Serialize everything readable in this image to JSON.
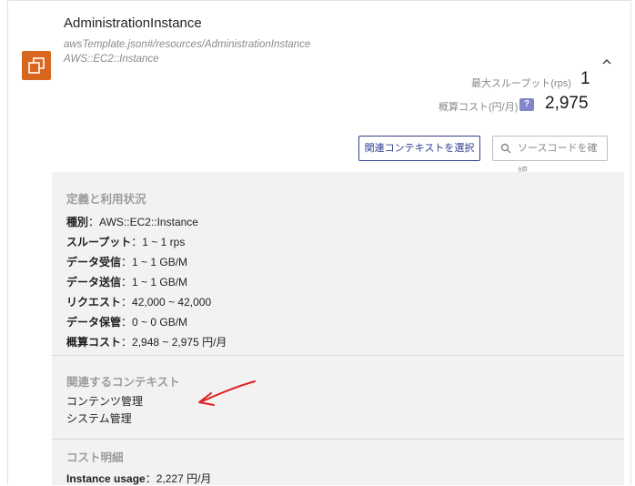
{
  "resource": {
    "name": "AdministrationInstance",
    "path": "awsTemplate.json#/resources/AdministrationInstance",
    "type": "AWS::EC2::Instance",
    "icon": "ec2-instance-icon",
    "icon_color": "#d9661e"
  },
  "metrics": {
    "throughput_label": "最大スループット(rps)",
    "throughput_value": "1",
    "cost_label": "概算コスト(円/月)",
    "help_label": "?",
    "cost_value": "2,975"
  },
  "buttons": {
    "context_label": "関連コンテキストを選択",
    "source_label": "ソースコードを確認"
  },
  "definition": {
    "title": "定義と利用状況",
    "rows": [
      {
        "label": "種別",
        "value": "AWS::EC2::Instance"
      },
      {
        "label": "スループット",
        "value": "1 ~ 1 rps"
      },
      {
        "label": "データ受信",
        "value": "1 ~ 1 GB/M"
      },
      {
        "label": "データ送信",
        "value": "1 ~ 1 GB/M"
      },
      {
        "label": "リクエスト",
        "value": "42,000 ~ 42,000"
      },
      {
        "label": "データ保管",
        "value": "0 ~ 0 GB/M"
      },
      {
        "label": "概算コスト",
        "value": "2,948 ~ 2,975 円/月"
      }
    ],
    "separator": "："
  },
  "context": {
    "title": "関連するコンテキスト",
    "items": [
      "コンテンツ管理",
      "システム管理"
    ]
  },
  "cost_detail": {
    "title": "コスト明細",
    "rows": [
      {
        "label": "Instance usage",
        "value": "2,227  円/月"
      }
    ]
  },
  "colors": {
    "accent": "#2f3f8f",
    "annotation_arrow": "#e02020",
    "panel_bg": "#f2f2f2"
  }
}
